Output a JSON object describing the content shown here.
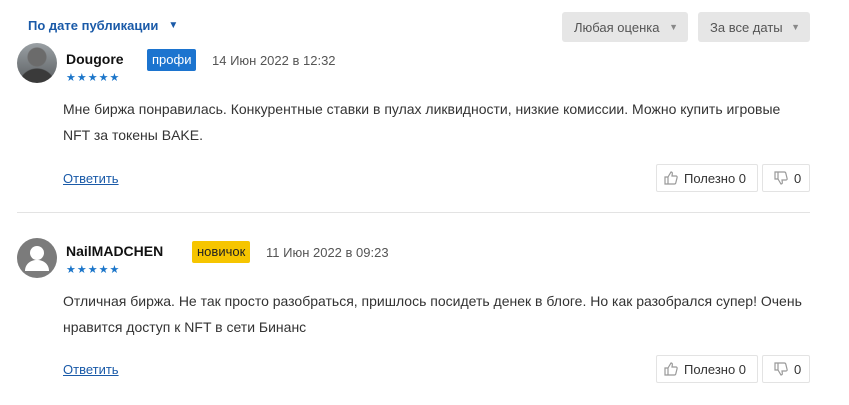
{
  "filters": {
    "sort_label": "По дате публикации",
    "rating_label": "Любая оценка",
    "dates_label": "За все даты"
  },
  "reviews": [
    {
      "author": "Dougore",
      "badge": "профи",
      "date": "14 Июн 2022 в 12:32",
      "stars": "★★★★★",
      "rating": 5,
      "text": "Мне биржа понравилась. Конкурентные ставки в пулах ликвидности, низкие комиссии. Можно купить игровые NFT за токены BAKE.",
      "reply_label": "Ответить",
      "helpful_label": "Полезно 0",
      "dislike_count": "0"
    },
    {
      "author": "NailMADCHEN",
      "badge": "новичок",
      "date": "11 Июн 2022 в 09:23",
      "stars": "★★★★★",
      "rating": 5,
      "text": "Отличная биржа. Не так просто разобраться, пришлось посидеть денек в блоге. Но как разобрался супер! Очень нравится доступ к NFT в сети Бинанс",
      "reply_label": "Ответить",
      "helpful_label": "Полезно 0",
      "dislike_count": "0"
    }
  ],
  "icons": {
    "sort_caret": "triangle-down",
    "select_caret": "triangle-down",
    "like": "thumb-up-outline",
    "dislike": "thumb-down-outline"
  },
  "colors": {
    "link": "#1a5aa8",
    "star": "#1b75c9",
    "badge_pro": "#1c74cf",
    "badge_new": "#f6c500"
  }
}
